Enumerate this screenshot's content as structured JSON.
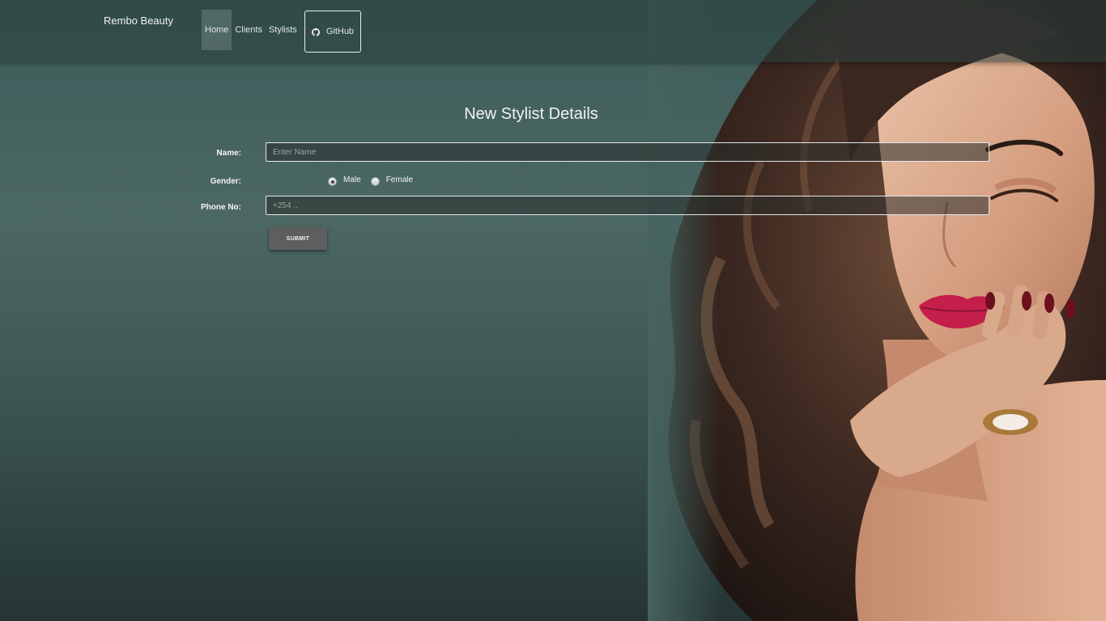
{
  "navbar": {
    "brand": "Rembo Beauty",
    "links": [
      {
        "label": "Home",
        "active": true
      },
      {
        "label": "Clients",
        "active": false
      },
      {
        "label": "Stylists",
        "active": false
      }
    ],
    "github": {
      "label": "GitHub",
      "icon": "github-icon"
    }
  },
  "form": {
    "title": "New Stylist Details",
    "name": {
      "label": "Name:",
      "value": "",
      "placeholder": "Enter Name"
    },
    "gender": {
      "label": "Gender:",
      "options": [
        {
          "label": "Male",
          "checked": true
        },
        {
          "label": "Female",
          "checked": false
        }
      ]
    },
    "phone": {
      "label": "Phone No:",
      "value": "",
      "placeholder": "+254 .."
    },
    "submit_label": "SUBMIT"
  },
  "colors": {
    "background": "#4c6864",
    "navbar": "#2e4644",
    "button": "#5c5f5e",
    "lips": "#c41f4a"
  }
}
